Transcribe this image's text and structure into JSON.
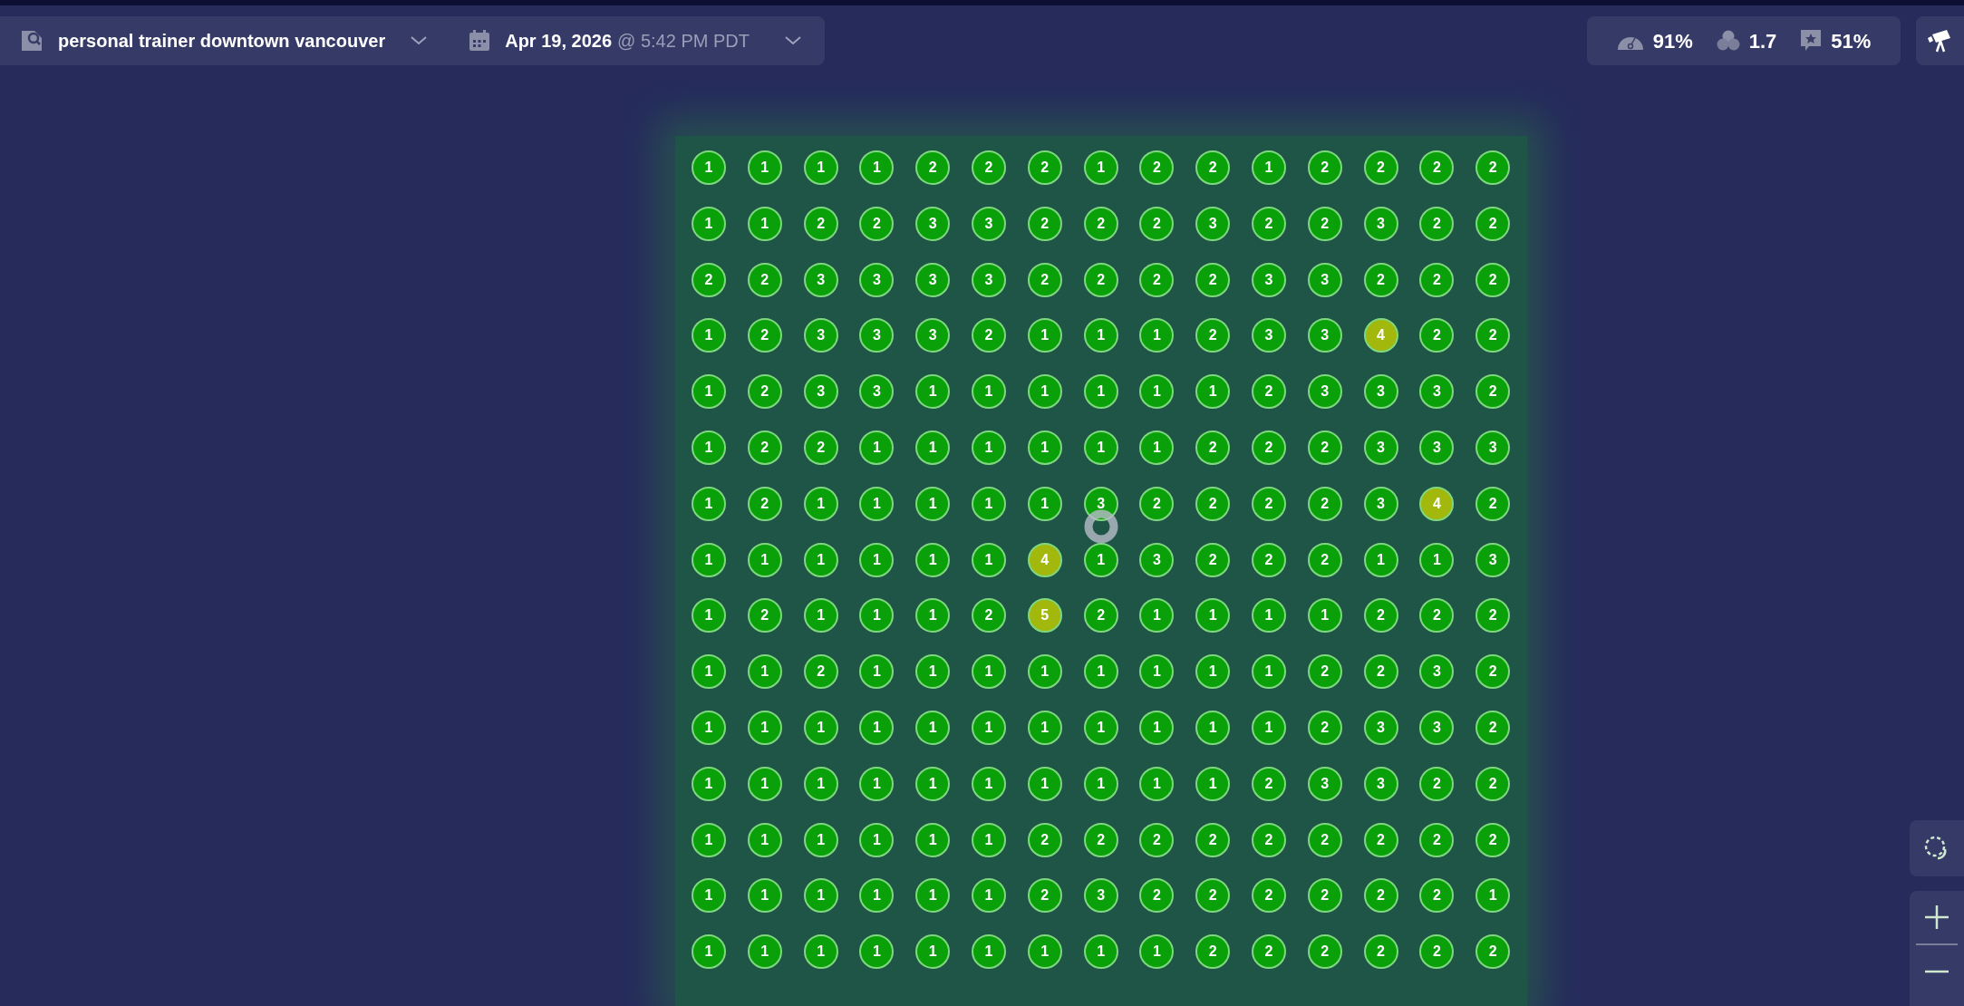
{
  "search": {
    "keyword": "personal trainer downtown vancouver",
    "date": "Apr 19, 2026",
    "time": "@ 5:42 PM PDT"
  },
  "stats": [
    {
      "kind": "gauge",
      "value": "91%"
    },
    {
      "kind": "circles",
      "value": "1.7"
    },
    {
      "kind": "review",
      "value": "51%"
    }
  ],
  "grid": [
    [
      {
        "rank": "1",
        "color": "#0aa00a"
      },
      {
        "rank": "1",
        "color": "#0aa00a"
      },
      {
        "rank": "1",
        "color": "#0aa00a"
      },
      {
        "rank": "1",
        "color": "#0aa00a"
      },
      {
        "rank": "2",
        "color": "#0aa00a"
      },
      {
        "rank": "2",
        "color": "#0aa00a"
      },
      {
        "rank": "2",
        "color": "#0aa00a"
      },
      {
        "rank": "1",
        "color": "#0aa00a"
      },
      {
        "rank": "2",
        "color": "#0aa00a"
      },
      {
        "rank": "2",
        "color": "#0aa00a"
      },
      {
        "rank": "1",
        "color": "#0aa00a"
      },
      {
        "rank": "2",
        "color": "#0aa00a"
      },
      {
        "rank": "2",
        "color": "#0aa00a"
      },
      {
        "rank": "2",
        "color": "#0aa00a"
      },
      {
        "rank": "2",
        "color": "#0aa00a"
      }
    ],
    [
      {
        "rank": "1",
        "color": "#0aa00a"
      },
      {
        "rank": "1",
        "color": "#0aa00a"
      },
      {
        "rank": "2",
        "color": "#0aa00a"
      },
      {
        "rank": "2",
        "color": "#0aa00a"
      },
      {
        "rank": "3",
        "color": "#0aa00a"
      },
      {
        "rank": "3",
        "color": "#0aa00a"
      },
      {
        "rank": "2",
        "color": "#0aa00a"
      },
      {
        "rank": "2",
        "color": "#0aa00a"
      },
      {
        "rank": "2",
        "color": "#0aa00a"
      },
      {
        "rank": "3",
        "color": "#0aa00a"
      },
      {
        "rank": "2",
        "color": "#0aa00a"
      },
      {
        "rank": "2",
        "color": "#0aa00a"
      },
      {
        "rank": "3",
        "color": "#0aa00a"
      },
      {
        "rank": "2",
        "color": "#0aa00a"
      },
      {
        "rank": "2",
        "color": "#0aa00a"
      }
    ],
    [
      {
        "rank": "2",
        "color": "#0aa00a"
      },
      {
        "rank": "2",
        "color": "#0aa00a"
      },
      {
        "rank": "3",
        "color": "#0aa00a"
      },
      {
        "rank": "3",
        "color": "#0aa00a"
      },
      {
        "rank": "3",
        "color": "#0aa00a"
      },
      {
        "rank": "3",
        "color": "#0aa00a"
      },
      {
        "rank": "2",
        "color": "#0aa00a"
      },
      {
        "rank": "2",
        "color": "#0aa00a"
      },
      {
        "rank": "2",
        "color": "#0aa00a"
      },
      {
        "rank": "2",
        "color": "#0aa00a"
      },
      {
        "rank": "3",
        "color": "#0aa00a"
      },
      {
        "rank": "3",
        "color": "#0aa00a"
      },
      {
        "rank": "2",
        "color": "#0aa00a"
      },
      {
        "rank": "2",
        "color": "#0aa00a"
      },
      {
        "rank": "2",
        "color": "#0aa00a"
      }
    ],
    [
      {
        "rank": "1",
        "color": "#0aa00a"
      },
      {
        "rank": "2",
        "color": "#0aa00a"
      },
      {
        "rank": "3",
        "color": "#0aa00a"
      },
      {
        "rank": "3",
        "color": "#0aa00a"
      },
      {
        "rank": "3",
        "color": "#0aa00a"
      },
      {
        "rank": "2",
        "color": "#0aa00a"
      },
      {
        "rank": "1",
        "color": "#0aa00a"
      },
      {
        "rank": "1",
        "color": "#0aa00a"
      },
      {
        "rank": "1",
        "color": "#0aa00a"
      },
      {
        "rank": "2",
        "color": "#0aa00a"
      },
      {
        "rank": "3",
        "color": "#0aa00a"
      },
      {
        "rank": "3",
        "color": "#0aa00a"
      },
      {
        "rank": "4",
        "color": "#a3b80c"
      },
      {
        "rank": "2",
        "color": "#0aa00a"
      },
      {
        "rank": "2",
        "color": "#0aa00a"
      }
    ],
    [
      {
        "rank": "1",
        "color": "#0aa00a"
      },
      {
        "rank": "2",
        "color": "#0aa00a"
      },
      {
        "rank": "3",
        "color": "#0aa00a"
      },
      {
        "rank": "3",
        "color": "#0aa00a"
      },
      {
        "rank": "1",
        "color": "#0aa00a"
      },
      {
        "rank": "1",
        "color": "#0aa00a"
      },
      {
        "rank": "1",
        "color": "#0aa00a"
      },
      {
        "rank": "1",
        "color": "#0aa00a"
      },
      {
        "rank": "1",
        "color": "#0aa00a"
      },
      {
        "rank": "1",
        "color": "#0aa00a"
      },
      {
        "rank": "2",
        "color": "#0aa00a"
      },
      {
        "rank": "3",
        "color": "#0aa00a"
      },
      {
        "rank": "3",
        "color": "#0aa00a"
      },
      {
        "rank": "3",
        "color": "#0aa00a"
      },
      {
        "rank": "2",
        "color": "#0aa00a"
      }
    ],
    [
      {
        "rank": "1",
        "color": "#0aa00a"
      },
      {
        "rank": "2",
        "color": "#0aa00a"
      },
      {
        "rank": "2",
        "color": "#0aa00a"
      },
      {
        "rank": "1",
        "color": "#0aa00a"
      },
      {
        "rank": "1",
        "color": "#0aa00a"
      },
      {
        "rank": "1",
        "color": "#0aa00a"
      },
      {
        "rank": "1",
        "color": "#0aa00a"
      },
      {
        "rank": "1",
        "color": "#0aa00a"
      },
      {
        "rank": "1",
        "color": "#0aa00a"
      },
      {
        "rank": "2",
        "color": "#0aa00a"
      },
      {
        "rank": "2",
        "color": "#0aa00a"
      },
      {
        "rank": "2",
        "color": "#0aa00a"
      },
      {
        "rank": "3",
        "color": "#0aa00a"
      },
      {
        "rank": "3",
        "color": "#0aa00a"
      },
      {
        "rank": "3",
        "color": "#0aa00a"
      }
    ],
    [
      {
        "rank": "1",
        "color": "#0aa00a"
      },
      {
        "rank": "2",
        "color": "#0aa00a"
      },
      {
        "rank": "1",
        "color": "#0aa00a"
      },
      {
        "rank": "1",
        "color": "#0aa00a"
      },
      {
        "rank": "1",
        "color": "#0aa00a"
      },
      {
        "rank": "1",
        "color": "#0aa00a"
      },
      {
        "rank": "1",
        "color": "#0aa00a"
      },
      {
        "rank": "3",
        "color": "#0aa00a"
      },
      {
        "rank": "2",
        "color": "#0aa00a"
      },
      {
        "rank": "2",
        "color": "#0aa00a"
      },
      {
        "rank": "2",
        "color": "#0aa00a"
      },
      {
        "rank": "2",
        "color": "#0aa00a"
      },
      {
        "rank": "3",
        "color": "#0aa00a"
      },
      {
        "rank": "4",
        "color": "#a3b80c"
      },
      {
        "rank": "2",
        "color": "#0aa00a"
      }
    ],
    [
      {
        "rank": "1",
        "color": "#0aa00a"
      },
      {
        "rank": "1",
        "color": "#0aa00a"
      },
      {
        "rank": "1",
        "color": "#0aa00a"
      },
      {
        "rank": "1",
        "color": "#0aa00a"
      },
      {
        "rank": "1",
        "color": "#0aa00a"
      },
      {
        "rank": "1",
        "color": "#0aa00a"
      },
      {
        "rank": "4",
        "color": "#a3b80c"
      },
      {
        "rank": "1",
        "color": "#0aa00a"
      },
      {
        "rank": "3",
        "color": "#0aa00a"
      },
      {
        "rank": "2",
        "color": "#0aa00a"
      },
      {
        "rank": "2",
        "color": "#0aa00a"
      },
      {
        "rank": "2",
        "color": "#0aa00a"
      },
      {
        "rank": "1",
        "color": "#0aa00a"
      },
      {
        "rank": "1",
        "color": "#0aa00a"
      },
      {
        "rank": "3",
        "color": "#0aa00a"
      }
    ],
    [
      {
        "rank": "1",
        "color": "#0aa00a"
      },
      {
        "rank": "2",
        "color": "#0aa00a"
      },
      {
        "rank": "1",
        "color": "#0aa00a"
      },
      {
        "rank": "1",
        "color": "#0aa00a"
      },
      {
        "rank": "1",
        "color": "#0aa00a"
      },
      {
        "rank": "2",
        "color": "#0aa00a"
      },
      {
        "rank": "5",
        "color": "#a3b80c"
      },
      {
        "rank": "2",
        "color": "#0aa00a"
      },
      {
        "rank": "1",
        "color": "#0aa00a"
      },
      {
        "rank": "1",
        "color": "#0aa00a"
      },
      {
        "rank": "1",
        "color": "#0aa00a"
      },
      {
        "rank": "1",
        "color": "#0aa00a"
      },
      {
        "rank": "2",
        "color": "#0aa00a"
      },
      {
        "rank": "2",
        "color": "#0aa00a"
      },
      {
        "rank": "2",
        "color": "#0aa00a"
      }
    ],
    [
      {
        "rank": "1",
        "color": "#0aa00a"
      },
      {
        "rank": "1",
        "color": "#0aa00a"
      },
      {
        "rank": "2",
        "color": "#0aa00a"
      },
      {
        "rank": "1",
        "color": "#0aa00a"
      },
      {
        "rank": "1",
        "color": "#0aa00a"
      },
      {
        "rank": "1",
        "color": "#0aa00a"
      },
      {
        "rank": "1",
        "color": "#0aa00a"
      },
      {
        "rank": "1",
        "color": "#0aa00a"
      },
      {
        "rank": "1",
        "color": "#0aa00a"
      },
      {
        "rank": "1",
        "color": "#0aa00a"
      },
      {
        "rank": "1",
        "color": "#0aa00a"
      },
      {
        "rank": "2",
        "color": "#0aa00a"
      },
      {
        "rank": "2",
        "color": "#0aa00a"
      },
      {
        "rank": "3",
        "color": "#0aa00a"
      },
      {
        "rank": "2",
        "color": "#0aa00a"
      }
    ],
    [
      {
        "rank": "1",
        "color": "#0aa00a"
      },
      {
        "rank": "1",
        "color": "#0aa00a"
      },
      {
        "rank": "1",
        "color": "#0aa00a"
      },
      {
        "rank": "1",
        "color": "#0aa00a"
      },
      {
        "rank": "1",
        "color": "#0aa00a"
      },
      {
        "rank": "1",
        "color": "#0aa00a"
      },
      {
        "rank": "1",
        "color": "#0aa00a"
      },
      {
        "rank": "1",
        "color": "#0aa00a"
      },
      {
        "rank": "1",
        "color": "#0aa00a"
      },
      {
        "rank": "1",
        "color": "#0aa00a"
      },
      {
        "rank": "1",
        "color": "#0aa00a"
      },
      {
        "rank": "2",
        "color": "#0aa00a"
      },
      {
        "rank": "3",
        "color": "#0aa00a"
      },
      {
        "rank": "3",
        "color": "#0aa00a"
      },
      {
        "rank": "2",
        "color": "#0aa00a"
      }
    ],
    [
      {
        "rank": "1",
        "color": "#0aa00a"
      },
      {
        "rank": "1",
        "color": "#0aa00a"
      },
      {
        "rank": "1",
        "color": "#0aa00a"
      },
      {
        "rank": "1",
        "color": "#0aa00a"
      },
      {
        "rank": "1",
        "color": "#0aa00a"
      },
      {
        "rank": "1",
        "color": "#0aa00a"
      },
      {
        "rank": "1",
        "color": "#0aa00a"
      },
      {
        "rank": "1",
        "color": "#0aa00a"
      },
      {
        "rank": "1",
        "color": "#0aa00a"
      },
      {
        "rank": "1",
        "color": "#0aa00a"
      },
      {
        "rank": "2",
        "color": "#0aa00a"
      },
      {
        "rank": "3",
        "color": "#0aa00a"
      },
      {
        "rank": "3",
        "color": "#0aa00a"
      },
      {
        "rank": "2",
        "color": "#0aa00a"
      },
      {
        "rank": "2",
        "color": "#0aa00a"
      }
    ],
    [
      {
        "rank": "1",
        "color": "#0aa00a"
      },
      {
        "rank": "1",
        "color": "#0aa00a"
      },
      {
        "rank": "1",
        "color": "#0aa00a"
      },
      {
        "rank": "1",
        "color": "#0aa00a"
      },
      {
        "rank": "1",
        "color": "#0aa00a"
      },
      {
        "rank": "1",
        "color": "#0aa00a"
      },
      {
        "rank": "2",
        "color": "#0aa00a"
      },
      {
        "rank": "2",
        "color": "#0aa00a"
      },
      {
        "rank": "2",
        "color": "#0aa00a"
      },
      {
        "rank": "2",
        "color": "#0aa00a"
      },
      {
        "rank": "2",
        "color": "#0aa00a"
      },
      {
        "rank": "2",
        "color": "#0aa00a"
      },
      {
        "rank": "2",
        "color": "#0aa00a"
      },
      {
        "rank": "2",
        "color": "#0aa00a"
      },
      {
        "rank": "2",
        "color": "#0aa00a"
      }
    ],
    [
      {
        "rank": "1",
        "color": "#0aa00a"
      },
      {
        "rank": "1",
        "color": "#0aa00a"
      },
      {
        "rank": "1",
        "color": "#0aa00a"
      },
      {
        "rank": "1",
        "color": "#0aa00a"
      },
      {
        "rank": "1",
        "color": "#0aa00a"
      },
      {
        "rank": "1",
        "color": "#0aa00a"
      },
      {
        "rank": "2",
        "color": "#0aa00a"
      },
      {
        "rank": "3",
        "color": "#0aa00a"
      },
      {
        "rank": "2",
        "color": "#0aa00a"
      },
      {
        "rank": "2",
        "color": "#0aa00a"
      },
      {
        "rank": "2",
        "color": "#0aa00a"
      },
      {
        "rank": "2",
        "color": "#0aa00a"
      },
      {
        "rank": "2",
        "color": "#0aa00a"
      },
      {
        "rank": "2",
        "color": "#0aa00a"
      },
      {
        "rank": "1",
        "color": "#0aa00a"
      }
    ],
    [
      {
        "rank": "1",
        "color": "#0aa00a"
      },
      {
        "rank": "1",
        "color": "#0aa00a"
      },
      {
        "rank": "1",
        "color": "#0aa00a"
      },
      {
        "rank": "1",
        "color": "#0aa00a"
      },
      {
        "rank": "1",
        "color": "#0aa00a"
      },
      {
        "rank": "1",
        "color": "#0aa00a"
      },
      {
        "rank": "1",
        "color": "#0aa00a"
      },
      {
        "rank": "1",
        "color": "#0aa00a"
      },
      {
        "rank": "1",
        "color": "#0aa00a"
      },
      {
        "rank": "2",
        "color": "#0aa00a"
      },
      {
        "rank": "2",
        "color": "#0aa00a"
      },
      {
        "rank": "2",
        "color": "#0aa00a"
      },
      {
        "rank": "2",
        "color": "#0aa00a"
      },
      {
        "rank": "2",
        "color": "#0aa00a"
      },
      {
        "rank": "2",
        "color": "#0aa00a"
      }
    ]
  ]
}
